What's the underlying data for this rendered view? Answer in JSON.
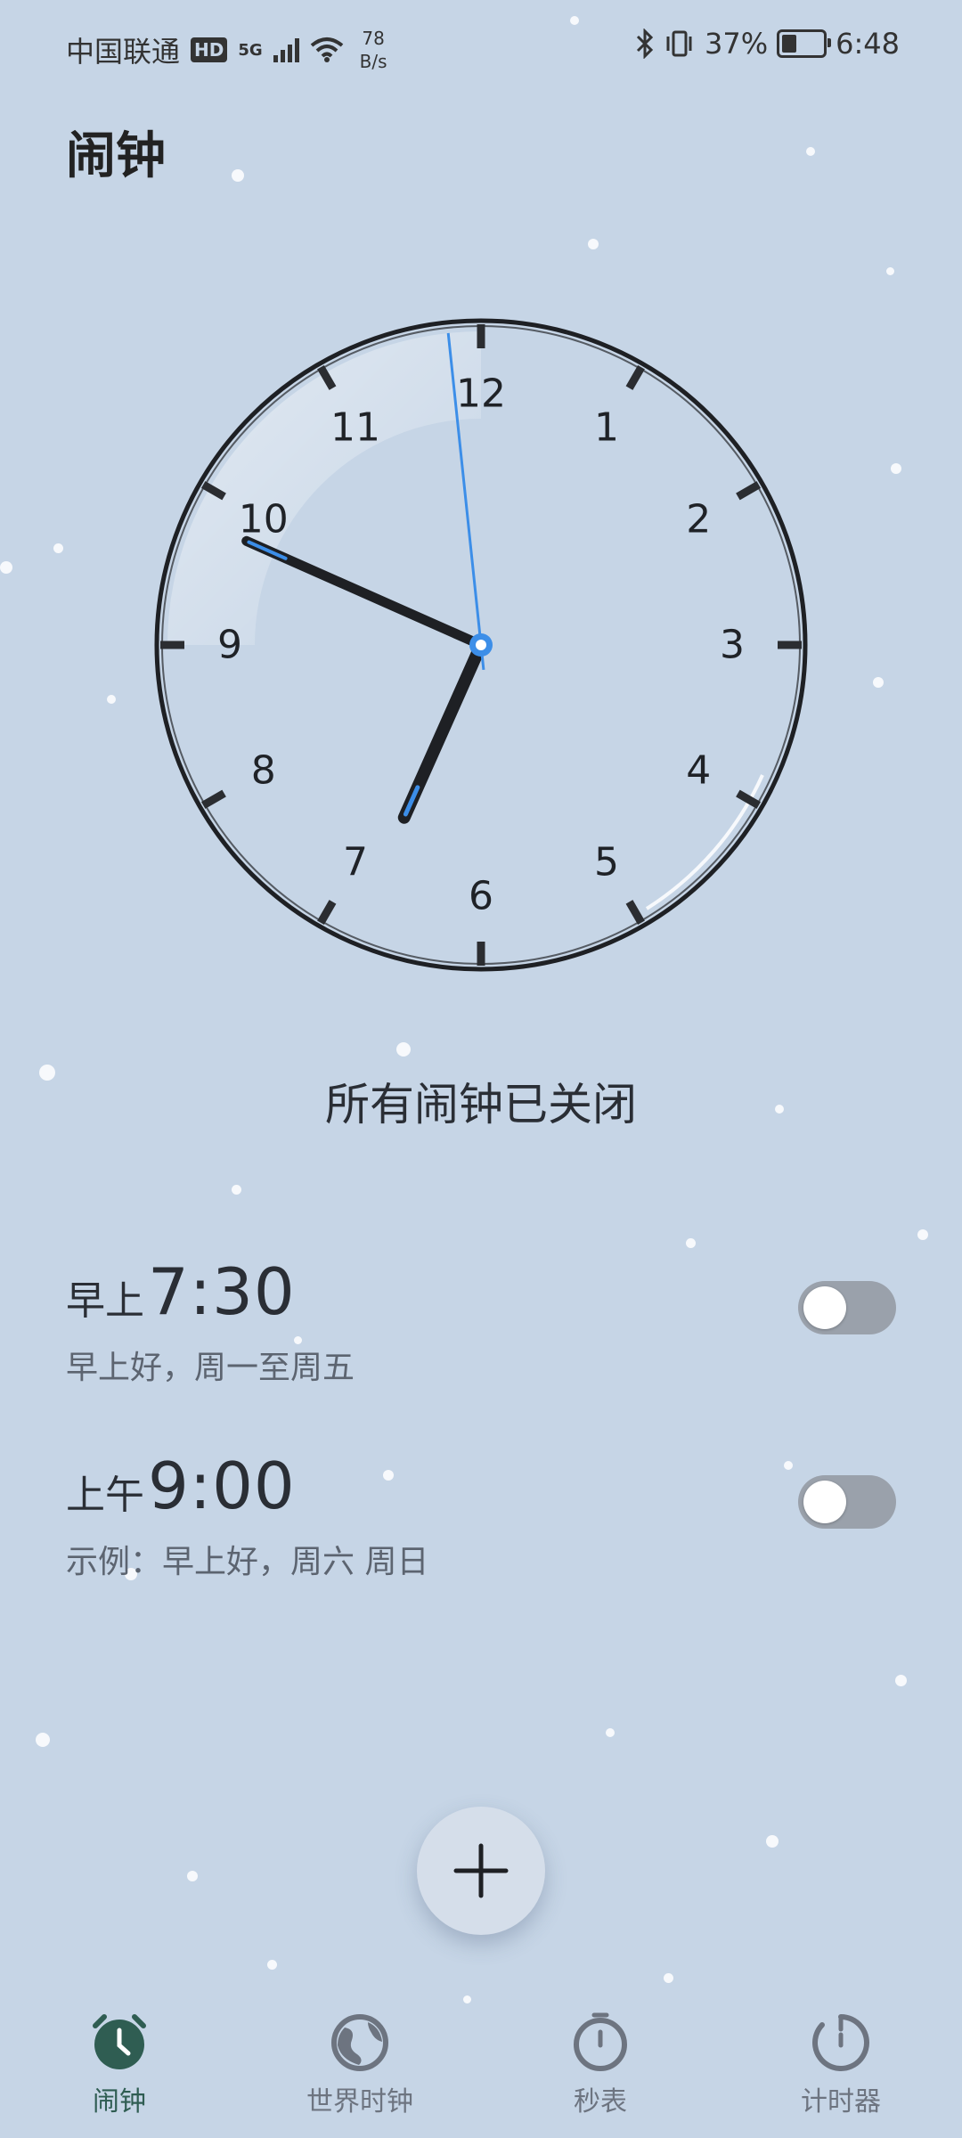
{
  "status_bar": {
    "carrier": "中国联通",
    "hd": "HD",
    "network": "5G",
    "speed_value": "78",
    "speed_unit": "B/s",
    "battery": "37%",
    "battery_level": 0.37,
    "time": "6:48"
  },
  "page_title": "闹钟",
  "clock": {
    "numbers": [
      "12",
      "1",
      "2",
      "3",
      "4",
      "5",
      "6",
      "7",
      "8",
      "9",
      "10",
      "11"
    ],
    "hour": 6,
    "minute": 48,
    "second": 59,
    "second_hand_color": "#3c8ee8"
  },
  "all_off_text": "所有闹钟已关闭",
  "alarms": [
    {
      "prefix": "早上",
      "time": "7:30",
      "desc": "早上好，周一至周五",
      "enabled": false
    },
    {
      "prefix": "上午",
      "time": "9:00",
      "desc": "示例：早上好，周六 周日",
      "enabled": false
    }
  ],
  "add_button_icon": "plus-icon",
  "tabs": [
    {
      "label": "闹钟",
      "icon": "alarm-clock-icon",
      "active": true
    },
    {
      "label": "世界时钟",
      "icon": "globe-icon",
      "active": false
    },
    {
      "label": "秒表",
      "icon": "stopwatch-icon",
      "active": false
    },
    {
      "label": "计时器",
      "icon": "timer-icon",
      "active": false
    }
  ],
  "colors": {
    "background": "#c6d5e6",
    "active_tab": "#2f5d52",
    "inactive_tab": "#6d7480",
    "toggle_off": "#9aa1ab"
  }
}
